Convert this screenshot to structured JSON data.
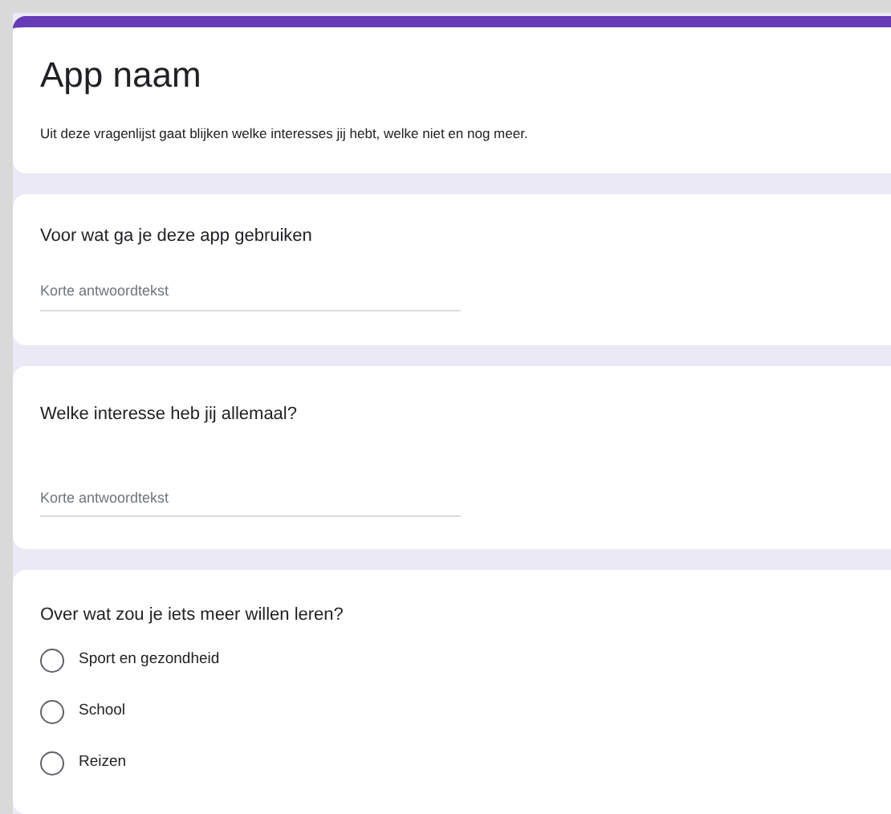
{
  "form": {
    "title": "App naam",
    "description": "Uit deze vragenlijst gaat blijken welke interesses jij hebt, welke niet en nog meer."
  },
  "questions": [
    {
      "kind": "short_text",
      "title": "Voor wat ga je deze app gebruiken",
      "placeholder": "Korte antwoordtekst"
    },
    {
      "kind": "short_text",
      "title": "Welke interesse heb jij allemaal?",
      "placeholder": "Korte antwoordtekst"
    },
    {
      "kind": "multiple_choice",
      "title": "Over wat zou je iets meer willen leren?",
      "options": [
        {
          "label": "Sport en gezondheid",
          "selected": false
        },
        {
          "label": "School",
          "selected": false
        },
        {
          "label": "Reizen",
          "selected": false
        }
      ]
    }
  ]
}
